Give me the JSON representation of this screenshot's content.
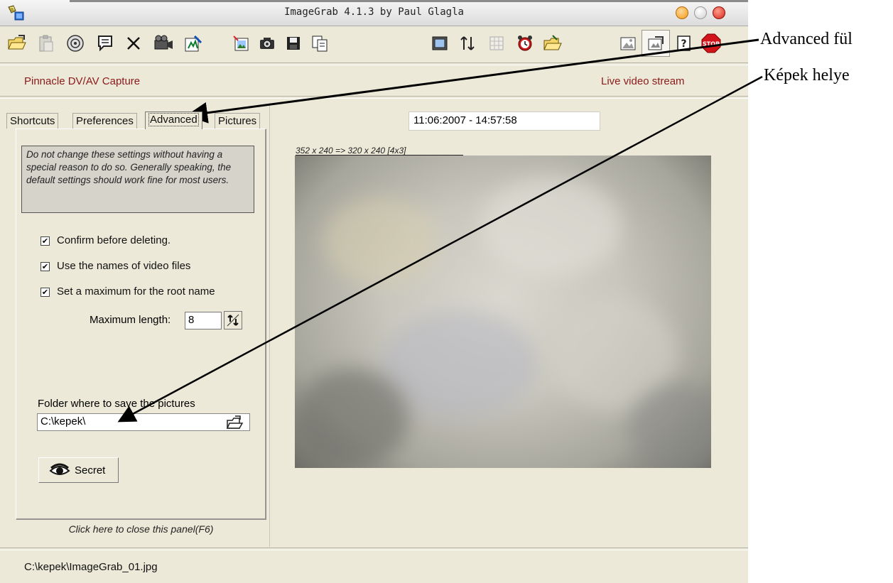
{
  "window": {
    "title": "ImageGrab 4.1.3 by Paul Glagla",
    "icon": "app-icon",
    "controls": [
      "minimize-button",
      "maximize-button",
      "close-button"
    ]
  },
  "toolbar": {
    "icons": [
      "open-folder-icon",
      "paste-icon",
      "cd-icon",
      "comment-icon",
      "delete-icon",
      "video-camera-icon",
      "edit-icon",
      "import-picture-icon",
      "camera-icon",
      "save-icon",
      "copy-icon",
      "display-icon",
      "adjust-icon",
      "grid-icon",
      "alarm-clock-icon",
      "open-output-folder-icon",
      "picture-icon",
      "options-icon",
      "help-icon",
      "stop-icon"
    ],
    "stop_label": "STOP"
  },
  "header": {
    "device": "Pinnacle DV/AV Capture",
    "stream": "Live video stream"
  },
  "tabs": [
    {
      "label": "Shortcuts"
    },
    {
      "label": "Preferences"
    },
    {
      "label": "Advanced",
      "active": true
    },
    {
      "label": "Pictures"
    }
  ],
  "advanced": {
    "warning": "Do not change these settings without having a special reason to do so. Generally speaking, the default settings should work fine for most users.",
    "options": [
      {
        "label": "Confirm before deleting.",
        "checked": true
      },
      {
        "label": "Use the names of video files",
        "checked": true
      },
      {
        "label": "Set a maximum for the root name",
        "checked": true
      }
    ],
    "max_length_label": "Maximum length:",
    "max_length_value": "8",
    "folder_label": "Folder where to save the pictures",
    "folder_value": "C:\\kepek\\",
    "secret_label": "Secret",
    "close_hint": "Click here to close this panel(F6)"
  },
  "preview": {
    "timestamp": "11:06:2007 - 14:57:58",
    "resolution": "352 x 240  =>  320 x 240 [4x3]"
  },
  "status": {
    "path": "C:\\kepek\\ImageGrab_01.jpg"
  },
  "annotations": {
    "advanced_tab": "Advanced fül",
    "pictures_folder": "Képek helye"
  }
}
